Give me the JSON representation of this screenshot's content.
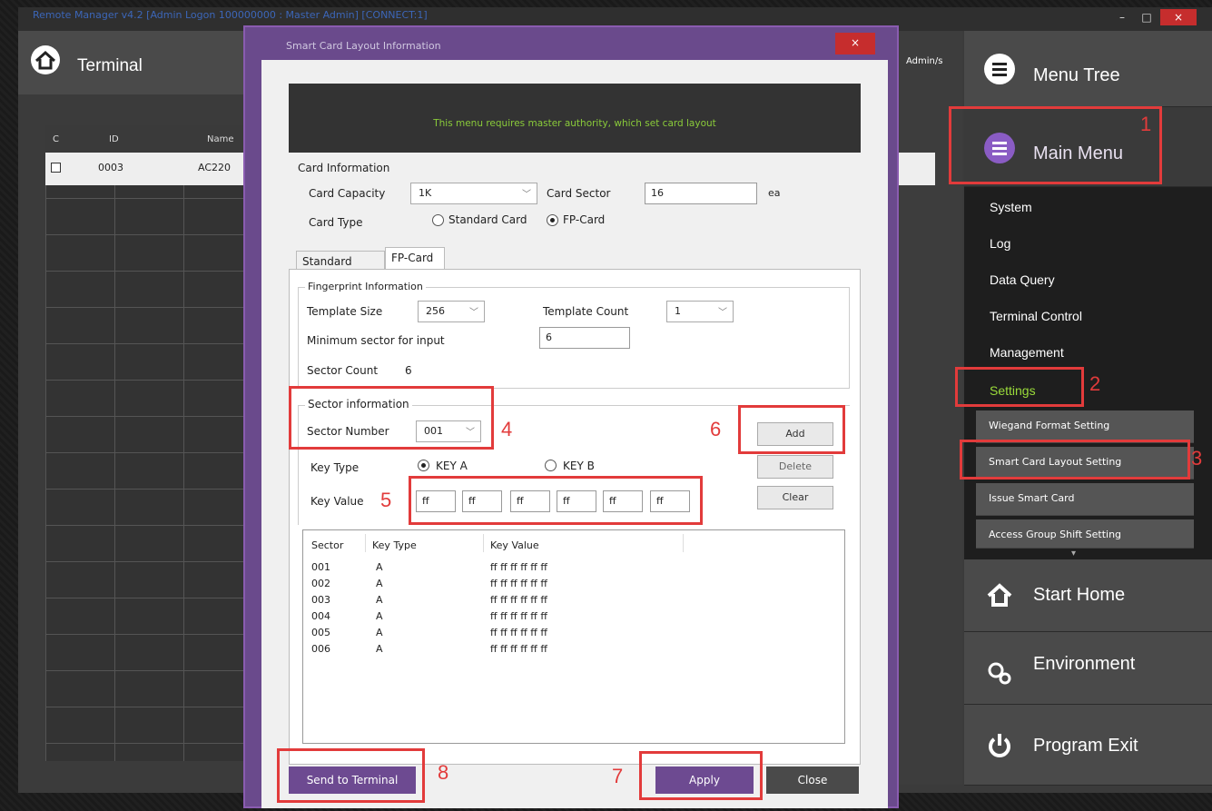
{
  "app": {
    "window_title": "Remote Manager v4.2 [Admin Logon 100000000 : Master Admin] [CONNECT:1]",
    "min_icon": "minimize-icon",
    "max_icon": "maximize-icon",
    "close_symbol": "×"
  },
  "terminal": {
    "title": "Terminal",
    "icon": "home-icon",
    "columns": [
      "C",
      "ID",
      "Name"
    ],
    "row": {
      "id": "0003",
      "name": "AC220"
    },
    "admin_label": "Admin/s"
  },
  "sidebar": {
    "menu_tree": "Menu Tree",
    "main_menu": "Main Menu",
    "items": [
      "System",
      "Log",
      "Data Query",
      "Terminal Control",
      "Management",
      "Settings"
    ],
    "sub_items": [
      "Wiegand Format Setting",
      "Smart Card Layout Setting",
      "Issue Smart Card",
      "Access Group Shift Setting"
    ],
    "start_home": "Start Home",
    "environment": "Environment",
    "program_exit": "Program Exit",
    "active_color": "#9bdc3a"
  },
  "dialog": {
    "title": "Smart Card Layout Information",
    "close_symbol": "×",
    "banner": "This menu requires master authority, which set card layout",
    "card_info": {
      "heading": "Card Information",
      "capacity_label": "Card Capacity",
      "capacity_value": "1K",
      "sector_label": "Card Sector",
      "sector_value": "16",
      "sector_unit": "ea",
      "type_label": "Card Type",
      "type_standard": "Standard Card",
      "type_fp": "FP-Card",
      "type_selected": "FP-Card"
    },
    "tabs": [
      "Standard Card",
      "FP-Card"
    ],
    "active_tab": "FP-Card",
    "fingerprint": {
      "heading": "Fingerprint Information",
      "template_size_label": "Template Size",
      "template_size_value": "256",
      "template_count_label": "Template Count",
      "template_count_value": "1",
      "min_sector_label": "Minimum sector for input",
      "min_sector_value": "6",
      "sector_count_label": "Sector Count",
      "sector_count_value": "6"
    },
    "sector": {
      "heading": "Sector information",
      "number_label": "Sector Number",
      "number_value": "001",
      "key_type_label": "Key Type",
      "key_a": "KEY A",
      "key_b": "KEY B",
      "key_selected": "KEY A",
      "key_value_label": "Key Value",
      "key_values": [
        "ff",
        "ff",
        "ff",
        "ff",
        "ff",
        "ff"
      ]
    },
    "buttons": {
      "add": "Add",
      "delete": "Delete",
      "clear": "Clear",
      "send": "Send to Terminal",
      "apply": "Apply",
      "close": "Close"
    },
    "list": {
      "headers": [
        "Sector",
        "Key Type",
        "Key Value"
      ],
      "rows": [
        {
          "sector": "001",
          "key_type": "A",
          "key_value": "ff ff ff ff ff ff"
        },
        {
          "sector": "002",
          "key_type": "A",
          "key_value": "ff ff ff ff ff ff"
        },
        {
          "sector": "003",
          "key_type": "A",
          "key_value": "ff ff ff ff ff ff"
        },
        {
          "sector": "004",
          "key_type": "A",
          "key_value": "ff ff ff ff ff ff"
        },
        {
          "sector": "005",
          "key_type": "A",
          "key_value": "ff ff ff ff ff ff"
        },
        {
          "sector": "006",
          "key_type": "A",
          "key_value": "ff ff ff ff ff ff"
        }
      ]
    }
  },
  "annotations": [
    "1",
    "2",
    "3",
    "4",
    "5",
    "6",
    "7",
    "8"
  ],
  "annotation_color": "#e23b3b"
}
